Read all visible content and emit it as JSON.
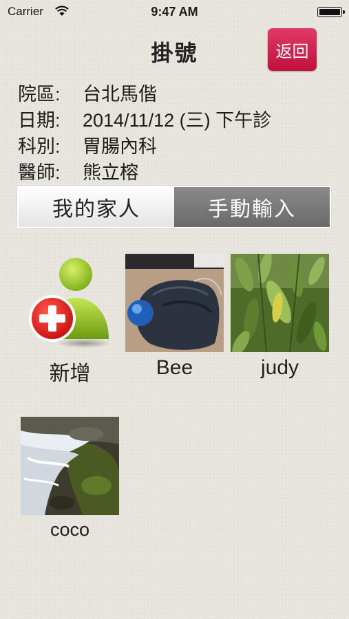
{
  "status_bar": {
    "carrier": "Carrier",
    "time": "9:47 AM"
  },
  "header": {
    "title": "掛號",
    "back_label": "返回"
  },
  "info": [
    {
      "label": "院區:",
      "value": "台北馬偕"
    },
    {
      "label": "日期:",
      "value": "2014/11/12 (三) 下午診"
    },
    {
      "label": "科別:",
      "value": "胃腸內科"
    },
    {
      "label": "醫師:",
      "value": "熊立榕"
    }
  ],
  "segment": {
    "options": [
      "我的家人",
      "手動輸入"
    ],
    "selected": "我的家人"
  },
  "members": {
    "add_label": "新增",
    "items": [
      {
        "name": "Bee",
        "photo": "trackball-mouse"
      },
      {
        "name": "judy",
        "photo": "green-leaves"
      },
      {
        "name": "coco",
        "photo": "waterfall-rocks"
      }
    ]
  },
  "colors": {
    "back_button": "#c0103e",
    "segment_inactive": "#7a7a7a",
    "background": "#e7e4db"
  }
}
